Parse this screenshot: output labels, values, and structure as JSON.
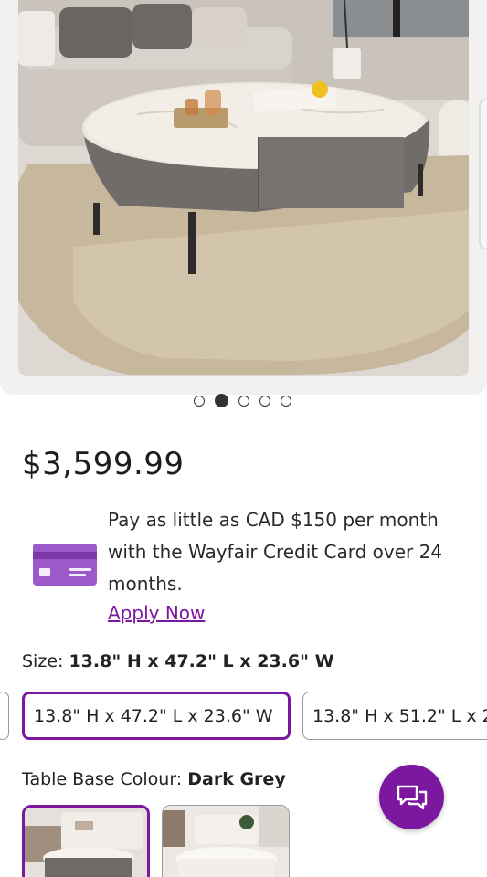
{
  "product": {
    "price": "$3,599.99",
    "carousel": {
      "total": 5,
      "active_index": 1
    }
  },
  "credit": {
    "text": "Pay as little as CAD $150 per month with the Wayfair Credit Card over 24 months.",
    "apply_label": "Apply Now",
    "card_color": "#9b59c9"
  },
  "size": {
    "label": "Size:",
    "selected_value": "13.8\" H x 47.2\" L x 23.6\" W",
    "options": [
      "13.8\" H x 47.2\" L x 23.6\" W",
      "13.8\" H x 51.2\" L x 2"
    ]
  },
  "colour": {
    "label": "Table Base Colour:",
    "selected_value": "Dark Grey"
  },
  "chat": {
    "icon": "chat-bubbles-icon"
  },
  "theme": {
    "accent": "#7b189f"
  }
}
